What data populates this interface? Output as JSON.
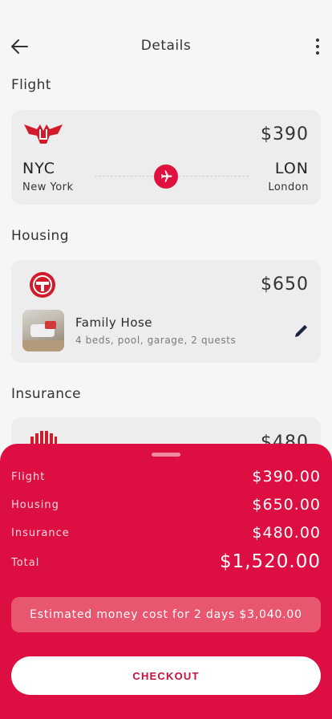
{
  "header": {
    "title": "Details"
  },
  "flight": {
    "section_label": "Flight",
    "price": "$390",
    "from_code": "NYC",
    "from_city": "New York",
    "to_code": "LON",
    "to_city": "London"
  },
  "housing": {
    "section_label": "Housing",
    "price": "$650",
    "name": "Family Hose",
    "description": "4 beds, pool, garage, 2 quests"
  },
  "insurance": {
    "section_label": "Insurance",
    "price": "$480"
  },
  "summary": {
    "rows": [
      {
        "label": "Flight",
        "value": "$390.00"
      },
      {
        "label": "Housing",
        "value": "$650.00"
      },
      {
        "label": "Insurance",
        "value": "$480.00"
      }
    ],
    "total_label": "Total",
    "total_value": "$1,520.00",
    "estimate_text": "Estimated money cost for 2 days $3,040.00",
    "checkout_label": "CHECKOUT"
  },
  "colors": {
    "accent": "#dd0e42",
    "background": "#f6f6f6",
    "card": "#ededed"
  }
}
